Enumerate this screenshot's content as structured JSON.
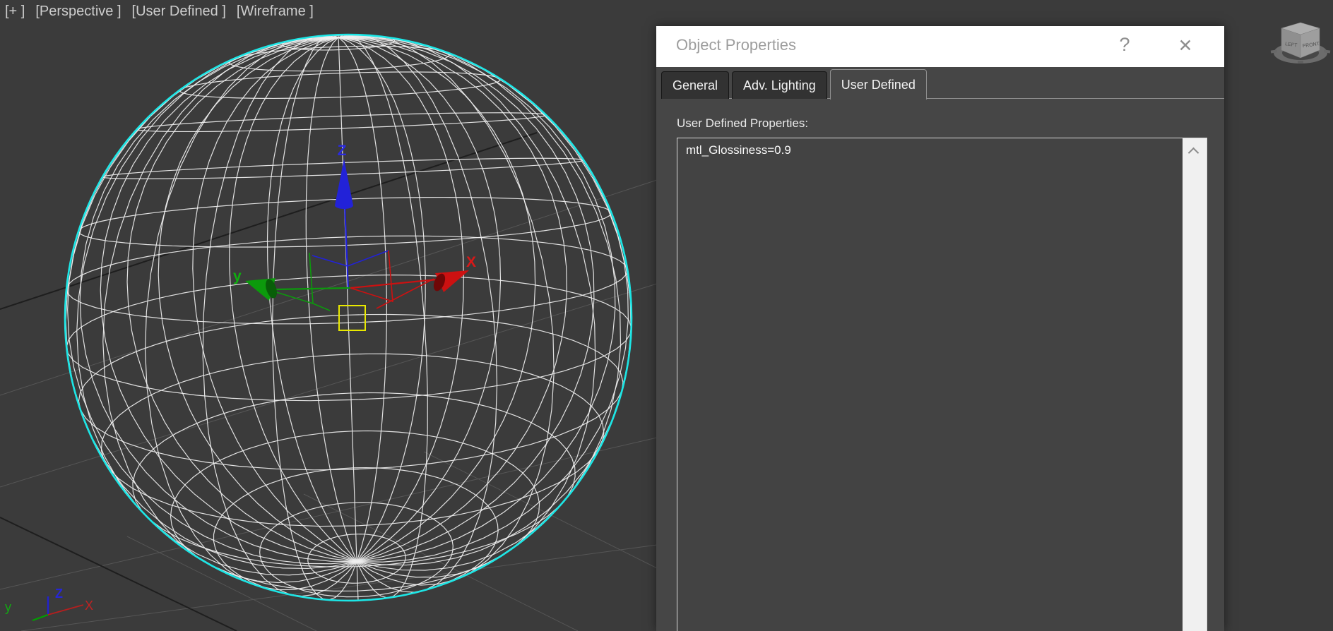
{
  "viewport": {
    "labels": {
      "plus": "[+ ]",
      "pov": "[Perspective ]",
      "user": "[User Defined ]",
      "shading": "[Wireframe ]"
    },
    "gizmo": {
      "x": "X",
      "y": "y",
      "z": "Z"
    },
    "world_axis": {
      "x": "X",
      "y": "y",
      "z": "Z"
    },
    "colors": {
      "background": "#3b3b3b",
      "wireframe": "#f0f0f0",
      "selection": "#1ce6e6",
      "axis_x": "#cc1111",
      "axis_y": "#0c9a0c",
      "axis_z": "#2222d8",
      "plane_handle": "#e8e800",
      "grid_gray": "#565656",
      "grid_dark": "#1e1e1e"
    }
  },
  "dialog": {
    "title": "Object Properties",
    "help_label": "?",
    "close_label": "✕",
    "tabs": [
      {
        "label": "General"
      },
      {
        "label": "Adv. Lighting"
      },
      {
        "label": "User Defined"
      }
    ],
    "properties_label": "User Defined Properties:",
    "properties_text": "mtl_Glossiness=0.9"
  },
  "viewcube": {
    "left_face": "LEFT",
    "front_face": "FRONT"
  }
}
